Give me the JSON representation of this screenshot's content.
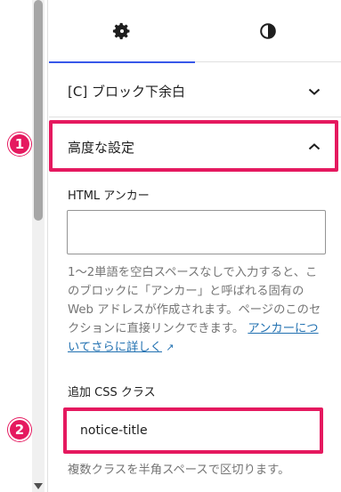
{
  "tabs": [
    {
      "name": "settings",
      "icon": "gear-icon",
      "active": true
    },
    {
      "name": "styles",
      "icon": "contrast-icon",
      "active": false
    }
  ],
  "panels": {
    "spacing": {
      "label": "[C] ブロック下余白",
      "icon": "chevron-down-icon",
      "expanded": false
    },
    "advanced": {
      "label": "高度な設定",
      "icon": "chevron-up-icon",
      "expanded": true
    }
  },
  "anchor": {
    "label": "HTML アンカー",
    "value": "",
    "help_text": "1〜2単語を空白スペースなしで入力すると、このブロックに「アンカー」と呼ばれる固有の Web アドレスが作成されます。ページのこのセクションに直接リンクできます。",
    "help_link": "アンカーについてさらに詳しく",
    "link_arrow": "↗"
  },
  "css_class": {
    "label": "追加 CSS クラス",
    "value": "notice-title",
    "help_text": "複数クラスを半角スペースで区切ります。"
  },
  "annotations": {
    "badge_1": "1",
    "badge_2": "2",
    "color": "#e5195f"
  },
  "colors": {
    "accent": "#3858e9",
    "link": "#2271b1",
    "help_text": "#757575"
  }
}
